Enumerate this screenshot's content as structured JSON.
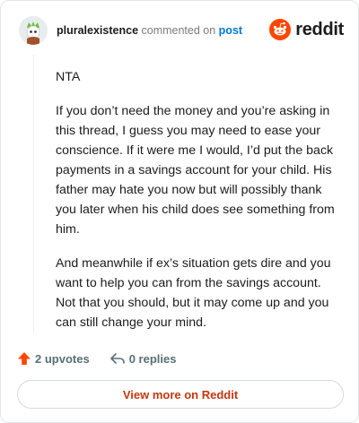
{
  "header": {
    "username": "pluralexistence",
    "action": "commented on",
    "post_link": "post",
    "brand": "reddit"
  },
  "comment": {
    "paragraphs": [
      "NTA",
      "If you don’t need the money and you’re asking in this thread, I guess you may need to ease your conscience. If it were me I would, I’d put the back payments in a savings account for your child. His father may hate you now but will possibly thank you later when his child does see something from him.",
      "And meanwhile if ex’s situation gets dire and you want to help you can from the savings account. Not that you should, but it may come up and you can still change your mind."
    ]
  },
  "footer": {
    "upvotes": "2 upvotes",
    "replies": "0 replies"
  },
  "view_more": "View more on Reddit",
  "icons": {
    "upvote": "upvote-arrow-icon",
    "reply": "reply-icon",
    "brand": "reddit-snoo-icon",
    "avatar": "user-avatar-icon"
  },
  "colors": {
    "upvote": "#ff4500",
    "link": "#0079d3",
    "view_more": "#c7360f",
    "brand_orange": "#ff4500"
  }
}
